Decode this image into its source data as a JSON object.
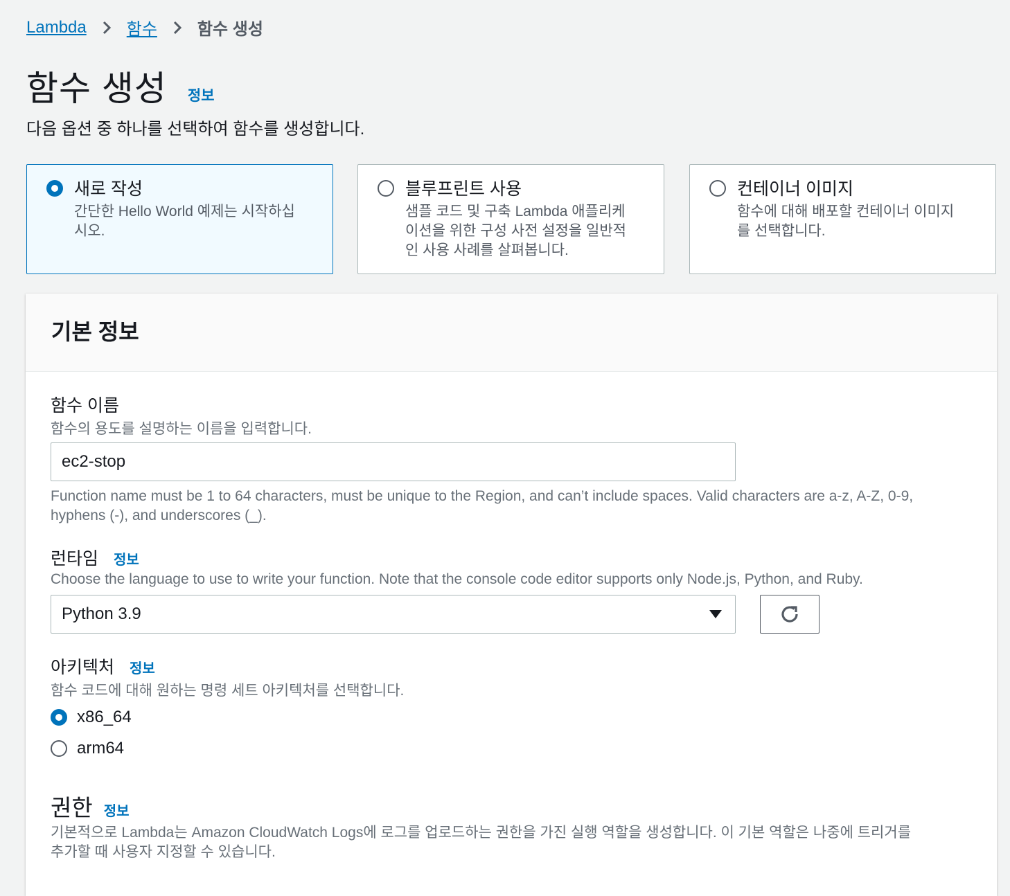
{
  "breadcrumb": {
    "items": [
      "Lambda",
      "함수"
    ],
    "current": "함수 생성"
  },
  "header": {
    "title": "함수 생성",
    "info": "정보",
    "description": "다음 옵션 중 하나를 선택하여 함수를 생성합니다."
  },
  "options": [
    {
      "title": "새로 작성",
      "desc_lines": [
        "간단한 Hello World 예제는 시작하십",
        "시오."
      ],
      "selected": true
    },
    {
      "title": "블루프린트 사용",
      "desc_lines": [
        "샘플 코드 및 구축 Lambda 애플리케",
        "이션을 위한 구성 사전 설정을 일반적",
        "인 사용 사례를 살펴봅니다."
      ],
      "selected": false
    },
    {
      "title": "컨테이너 이미지",
      "desc_lines": [
        "함수에 대해 배포할 컨테이너 이미지",
        "를 선택합니다."
      ],
      "selected": false
    }
  ],
  "basic_info": {
    "title": "기본 정보",
    "function_name": {
      "label": "함수 이름",
      "description": "함수의 용도를 설명하는 이름을 입력합니다.",
      "value": "ec2-stop",
      "constraint_lines": [
        "Function name must be 1 to 64 characters, must be unique to the Region, and can’t include spaces. Valid characters are a-z, A-Z, 0-9,",
        "hyphens (-), and underscores (_)."
      ]
    },
    "runtime": {
      "label": "런타임",
      "info": "정보",
      "description": "Choose the language to use to write your function. Note that the console code editor supports only Node.js, Python, and Ruby.",
      "value": "Python 3.9"
    },
    "architecture": {
      "label": "아키텍처",
      "info": "정보",
      "description": "함수 코드에 대해 원하는 명령 세트 아키텍처를 선택합니다.",
      "options": [
        "x86_64",
        "arm64"
      ],
      "selected": "x86_64"
    },
    "permissions": {
      "label": "권한",
      "info": "정보",
      "description_lines": [
        "기본적으로 Lambda는 Amazon CloudWatch Logs에 로그를 업로드하는 권한을 가진 실행 역할을 생성합니다. 이 기본 역할은 나중에 트리거를",
        "추가할 때 사용자 지정할 수 있습니다."
      ]
    }
  },
  "colors": {
    "accent": "#0073bb",
    "selected_bg": "#f1faff",
    "page_bg": "#f2f3f3"
  }
}
